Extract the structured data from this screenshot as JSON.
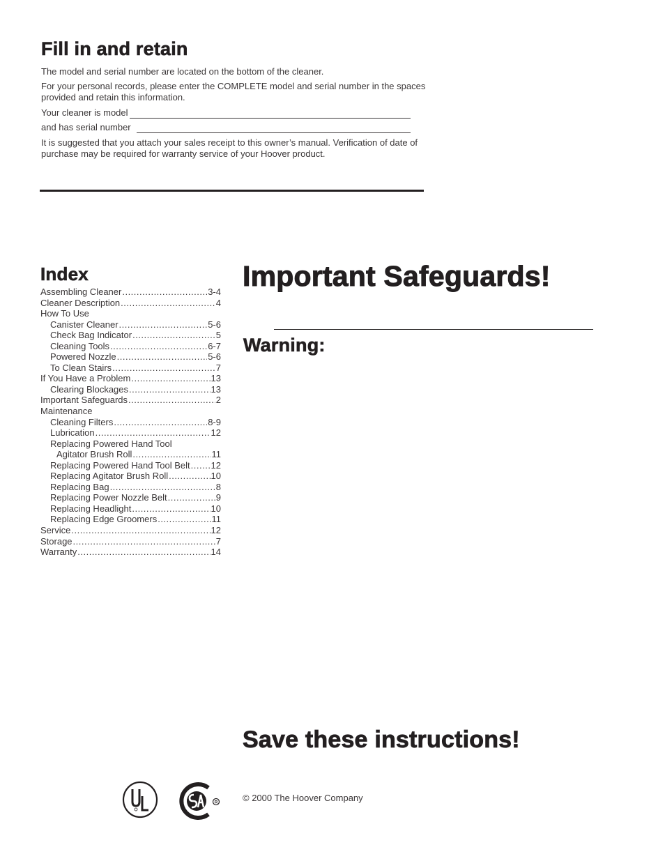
{
  "fill_in": {
    "title": "Fill in and retain",
    "para1": "The model and serial number are located on the bottom of the cleaner.",
    "para2": "For your personal records, please enter the COMPLETE model and serial number in the spaces provided and retain this information.",
    "model_label": "Your cleaner is model",
    "model_value": "",
    "serial_label": "and has serial number",
    "serial_value": "",
    "para3": "It is suggested that you attach your sales receipt to this owner’s manual. Verification of date of purchase may be required for warranty service of your Hoover product."
  },
  "index": {
    "title": "Index",
    "items": [
      {
        "label": "Assembling Cleaner",
        "page": "3-4",
        "level": 0
      },
      {
        "label": "Cleaner Description",
        "page": "4",
        "level": 0
      },
      {
        "label": "How To Use",
        "page": "",
        "level": 0
      },
      {
        "label": "Canister Cleaner",
        "page": "5-6",
        "level": 1
      },
      {
        "label": "Check Bag Indicator",
        "page": "5",
        "level": 1
      },
      {
        "label": "Cleaning Tools",
        "page": "6-7",
        "level": 1
      },
      {
        "label": "Powered Nozzle",
        "page": "5-6",
        "level": 1
      },
      {
        "label": "To Clean Stairs",
        "page": "7",
        "level": 1
      },
      {
        "label": "If You Have a Problem",
        "page": "13",
        "level": 0
      },
      {
        "label": "Clearing Blockages",
        "page": "13",
        "level": 1
      },
      {
        "label": "Important Safeguards",
        "page": "2",
        "level": 0
      },
      {
        "label": "Maintenance",
        "page": "",
        "level": 0
      },
      {
        "label": "Cleaning Filters",
        "page": "8-9",
        "level": 1
      },
      {
        "label": "Lubrication",
        "page": "12",
        "level": 1
      },
      {
        "label": "Replacing Powered Hand Tool",
        "page": "",
        "level": 1
      },
      {
        "label": "Agitator Brush Roll",
        "page": "11",
        "level": 2
      },
      {
        "label": "Replacing Powered Hand Tool Belt",
        "page": "12",
        "level": 1
      },
      {
        "label": "Replacing Agitator Brush Roll",
        "page": "10",
        "level": 1
      },
      {
        "label": "Replacing Bag",
        "page": "8",
        "level": 1
      },
      {
        "label": "Replacing Power Nozzle Belt",
        "page": "9",
        "level": 1
      },
      {
        "label": "Replacing Headlight",
        "page": "10",
        "level": 1
      },
      {
        "label": "Replacing Edge Groomers",
        "page": "11",
        "level": 1
      },
      {
        "label": "Service",
        "page": "12",
        "level": 0
      },
      {
        "label": "Storage",
        "page": "7",
        "level": 0
      },
      {
        "label": "Warranty",
        "page": "14",
        "level": 0
      }
    ]
  },
  "safeguards": {
    "title": "Important Safeguards!",
    "warning": "Warning:",
    "save": "Save these instructions!"
  },
  "footer": {
    "copyright": "© 2000 The Hoover Company",
    "logos": [
      "ul-listed-logo",
      "csa-logo"
    ],
    "ul_text": "UL",
    "registered": "®"
  }
}
